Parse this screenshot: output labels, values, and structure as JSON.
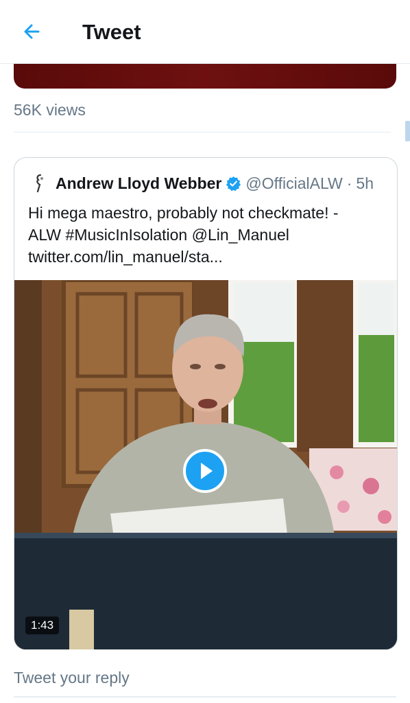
{
  "header": {
    "title": "Tweet",
    "back_icon": "arrow-left-icon"
  },
  "tweet": {
    "views": "56K views"
  },
  "quoted_tweet": {
    "author_name": "Andrew Lloyd Webber",
    "verified": true,
    "handle": "@OfficialALW",
    "separator": "·",
    "time": "5h",
    "text_lines": [
      "Hi mega maestro, probably not checkmate! -",
      "ALW #MusicInIsolation @Lin_Manuel",
      "twitter.com/lin_manuel/sta..."
    ],
    "video": {
      "duration": "1:43",
      "play_icon": "play-icon"
    }
  },
  "reply": {
    "placeholder": "Tweet your reply"
  },
  "colors": {
    "accent": "#1da1f2",
    "secondary_text": "#657786",
    "border": "#e6ecf0"
  }
}
